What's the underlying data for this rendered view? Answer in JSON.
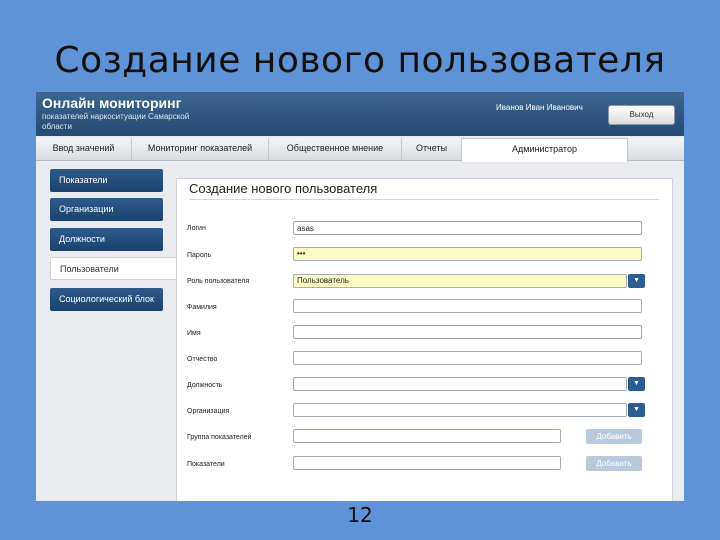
{
  "slide": {
    "title": "Создание нового пользователя",
    "page_number": "12"
  },
  "app": {
    "name": "Онлайн мониторинг",
    "subtitle": "показателей наркоситуации Самарской области",
    "user": "Иванов Иван Иванович",
    "logout_label": "Выход"
  },
  "tabs": [
    {
      "label": "Ввод значений"
    },
    {
      "label": "Мониторинг показателей"
    },
    {
      "label": "Общественное мнение"
    },
    {
      "label": "Отчеты"
    },
    {
      "label": "Администратор"
    }
  ],
  "sidebar": {
    "items": [
      {
        "label": "Показатели"
      },
      {
        "label": "Организации"
      },
      {
        "label": "Должности"
      },
      {
        "label": "Пользователи"
      },
      {
        "label": "Социологический блок"
      }
    ]
  },
  "form": {
    "title": "Создание нового пользователя",
    "login_label": "Логин",
    "login_value": "asas",
    "password_label": "Пароль",
    "password_value": "•••",
    "role_label": "Роль пользователя",
    "role_value": "Пользователь",
    "lastname_label": "Фамилия",
    "firstname_label": "Имя",
    "patronymic_label": "Отчество",
    "position_label": "Должность",
    "organization_label": "Организация",
    "indicator_group_label": "Группа показателей",
    "indicators_label": "Показатели",
    "add_label": "Добавить"
  },
  "colors": {
    "slide_background": "#5f93d8",
    "header": "#2f5782",
    "nav_button": "#24497a",
    "required_field": "#fdfbc4"
  }
}
